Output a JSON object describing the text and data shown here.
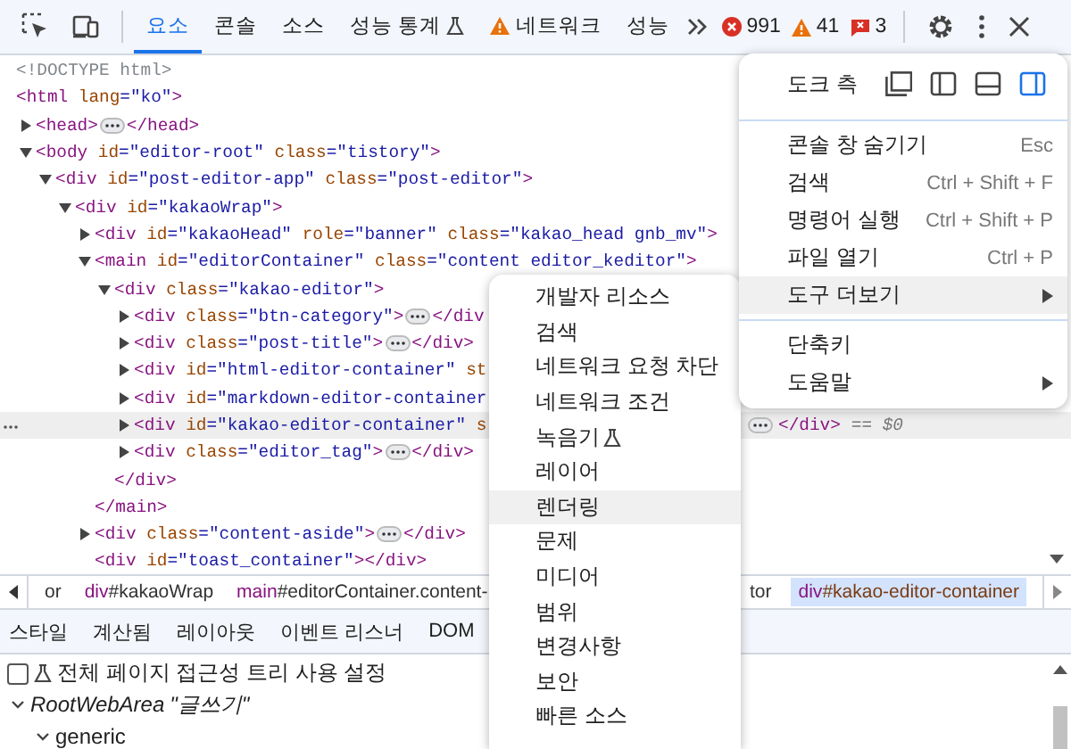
{
  "toolbar": {
    "tabs": [
      {
        "label": "요소",
        "selected": true,
        "kind": "plain"
      },
      {
        "label": "콘솔",
        "selected": false,
        "kind": "plain"
      },
      {
        "label": "소스",
        "selected": false,
        "kind": "plain"
      },
      {
        "label": "성능 통계",
        "selected": false,
        "kind": "experimental"
      },
      {
        "label": "네트워크",
        "selected": false,
        "kind": "warning"
      },
      {
        "label": "성능",
        "selected": false,
        "kind": "plain"
      }
    ],
    "counters": [
      {
        "kind": "error",
        "count": "991"
      },
      {
        "kind": "warning",
        "count": "41"
      },
      {
        "kind": "issue",
        "count": "3"
      }
    ]
  },
  "dom_tree": [
    {
      "kind": "doctype",
      "text": "<!DOCTYPE html>"
    },
    {
      "kind": "element",
      "text": "<html lang=\"ko\">",
      "children": [
        {
          "kind": "element",
          "text": "<head>",
          "expanded": false,
          "ellipsis": true,
          "close": "</head>"
        },
        {
          "kind": "element",
          "text": "<body id=\"editor-root\" class=\"tistory\">",
          "expanded": true,
          "children": [
            {
              "kind": "element",
              "text": "<div id=\"post-editor-app\" class=\"post-editor\">",
              "expanded": true,
              "children": [
                {
                  "kind": "element",
                  "text": "<div id=\"kakaoWrap\">",
                  "expanded": true,
                  "children": [
                    {
                      "kind": "element",
                      "text": "<div id=\"kakaoHead\" role=\"banner\" class=\"kakao_head gnb_mv\">",
                      "expanded": false
                    },
                    {
                      "kind": "element",
                      "text": "<main id=\"editorContainer\" class=\"content editor_keditor\">",
                      "expanded": true,
                      "close_line": "</main>",
                      "children": [
                        {
                          "kind": "element",
                          "text": "<div class=\"kakao-editor\">",
                          "expanded": true,
                          "close_line": "</div>",
                          "children": [
                            {
                              "kind": "element",
                              "text": "<div class=\"btn-category\">",
                              "expanded": false,
                              "ellipsis": true,
                              "close": "</div"
                            },
                            {
                              "kind": "element",
                              "text": "<div class=\"post-title\">",
                              "expanded": false,
                              "ellipsis": true,
                              "close": "</div>"
                            },
                            {
                              "kind": "element",
                              "text": "<div id=\"html-editor-container\" st",
                              "expanded": false
                            },
                            {
                              "kind": "element",
                              "text": "<div id=\"markdown-editor-container",
                              "expanded": false
                            },
                            {
                              "kind": "element",
                              "text": "<div id=\"kakao-editor-container\" s",
                              "expanded": false,
                              "selected": true,
                              "ellipsis": true,
                              "close": "</div>",
                              "ref": "== $0"
                            },
                            {
                              "kind": "element",
                              "text": "<div class=\"editor_tag\">",
                              "expanded": false,
                              "ellipsis": true,
                              "close": "</div>"
                            }
                          ]
                        }
                      ]
                    },
                    {
                      "kind": "element",
                      "text": "<div class=\"content-aside\">",
                      "expanded": false,
                      "ellipsis": true,
                      "close": "</div>"
                    },
                    {
                      "kind": "element",
                      "text": "<div id=\"toast_container\"></div>"
                    }
                  ]
                }
              ]
            }
          ]
        }
      ]
    }
  ],
  "breadcrumbs": [
    {
      "text": "or",
      "selected": false
    },
    {
      "text": "div#kakaoWrap",
      "selected": false
    },
    {
      "text": "main#editorContainer.content-",
      "selected": false
    },
    {
      "text": "tor",
      "selected": false
    },
    {
      "text": "div#kakao-editor-container",
      "selected": true
    }
  ],
  "panel_tabs": [
    "스타일",
    "계산됨",
    "레이아웃",
    "이벤트 리스너",
    "DOM"
  ],
  "accessibility": {
    "full_page_option": {
      "label": "전체 페이지 접근성 트리 사용 설정",
      "checked": false
    },
    "tree": [
      {
        "role": "RootWebArea",
        "name": "\"글쓰기\"",
        "expanded": true,
        "children": [
          {
            "role": "generic",
            "expanded": true
          }
        ]
      }
    ]
  },
  "main_menu": {
    "dock": {
      "label": "도크 측",
      "options": [
        {
          "kind": "undock",
          "selected": false
        },
        {
          "kind": "left",
          "selected": false
        },
        {
          "kind": "bottom",
          "selected": false
        },
        {
          "kind": "right",
          "selected": true
        }
      ]
    },
    "groups": [
      {
        "items": [
          {
            "label": "콘솔 창 숨기기",
            "shortcut": "Esc",
            "submenu": false,
            "selected": false
          },
          {
            "label": "검색",
            "shortcut": "Ctrl + Shift + F",
            "submenu": false,
            "selected": false
          },
          {
            "label": "명령어 실행",
            "shortcut": "Ctrl + Shift + P",
            "submenu": false,
            "selected": false
          },
          {
            "label": "파일 열기",
            "shortcut": "Ctrl + P",
            "submenu": false,
            "selected": false
          },
          {
            "label": "도구 더보기",
            "submenu": true,
            "selected": true
          }
        ]
      },
      {
        "items": [
          {
            "label": "단축키",
            "submenu": false,
            "selected": false
          },
          {
            "label": "도움말",
            "submenu": true,
            "selected": false
          }
        ]
      }
    ]
  },
  "more_tools_menu": {
    "items": [
      {
        "label": "개발자 리소스",
        "kind": "plain",
        "selected": false
      },
      {
        "label": "검색",
        "kind": "plain",
        "selected": false
      },
      {
        "label": "네트워크 요청 차단",
        "kind": "plain",
        "selected": false
      },
      {
        "label": "네트워크 조건",
        "kind": "plain",
        "selected": false
      },
      {
        "label": "녹음기",
        "kind": "experimental",
        "selected": false
      },
      {
        "label": "레이어",
        "kind": "plain",
        "selected": false
      },
      {
        "label": "렌더링",
        "kind": "plain",
        "selected": true
      },
      {
        "label": "문제",
        "kind": "plain",
        "selected": false
      },
      {
        "label": "미디어",
        "kind": "plain",
        "selected": false
      },
      {
        "label": "범위",
        "kind": "plain",
        "selected": false
      },
      {
        "label": "변경사항",
        "kind": "plain",
        "selected": false
      },
      {
        "label": "보안",
        "kind": "plain",
        "selected": false
      },
      {
        "label": "빠른 소스",
        "kind": "plain",
        "selected": false
      }
    ]
  }
}
